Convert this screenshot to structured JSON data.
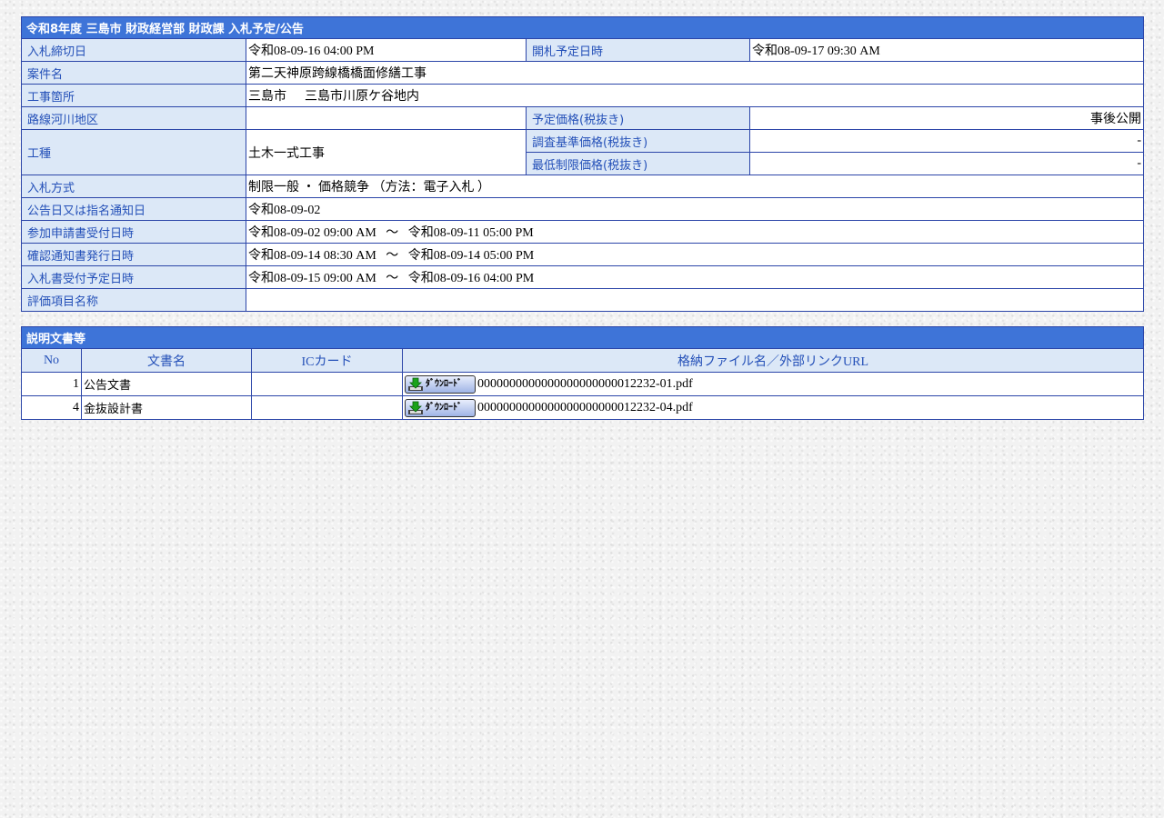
{
  "info_table": {
    "title": "令和8年度 三島市 財政経営部 財政課 入札予定/公告",
    "rows": {
      "deadline_label": "入札締切日",
      "deadline_value": "令和08-09-16 04:00 PM",
      "opening_label": "開札予定日時",
      "opening_value": "令和08-09-17 09:30 AM",
      "case_label": "案件名",
      "case_value": "第二天神原跨線橋橋面修繕工事",
      "location_label": "工事箇所",
      "location_city": "三島市",
      "location_detail": "三島市川原ケ谷地内",
      "route_label": "路線河川地区",
      "route_value": "",
      "planned_price_label": "予定価格(税抜き)",
      "planned_price_value": "事後公開",
      "work_type_label": "工種",
      "work_type_value": "土木一式工事",
      "survey_price_label": "調査基準価格(税抜き)",
      "survey_price_value": "-",
      "min_price_label": "最低制限価格(税抜き)",
      "min_price_value": "-",
      "method_label": "入札方式",
      "method_value": "制限一般 ・ 価格競争 （方法：電子入札 ）",
      "notice_date_label": "公告日又は指名通知日",
      "notice_date_value": "令和08-09-02",
      "application_label": "参加申請書受付日時",
      "application_start": "令和08-09-02 09:00 AM",
      "application_end": "令和08-09-11 05:00 PM",
      "confirm_label": "確認通知書発行日時",
      "confirm_start": "令和08-09-14 08:30 AM",
      "confirm_end": "令和08-09-14 05:00 PM",
      "bid_accept_label": "入札書受付予定日時",
      "bid_accept_start": "令和08-09-15 09:00 AM",
      "bid_accept_end": "令和08-09-16 04:00 PM",
      "eval_label": "評価項目名称",
      "eval_value": "",
      "range_sep": "～"
    }
  },
  "docs_table": {
    "title": "説明文書等",
    "headers": {
      "no": "No",
      "doc_name": "文書名",
      "ic_card": "ICカード",
      "file": "格納ファイル名／外部リンクURL"
    },
    "download_label": "ﾀﾞｳﾝﾛｰﾄﾞ",
    "rows": [
      {
        "no": "1",
        "doc_name": "公告文書",
        "ic_card": "",
        "file": "0000000000000000000000012232-01.pdf"
      },
      {
        "no": "4",
        "doc_name": "金抜設計書",
        "ic_card": "",
        "file": "0000000000000000000000012232-04.pdf"
      }
    ]
  },
  "colors": {
    "title_bg": "#3e74d8",
    "label_bg": "#dce8f7",
    "label_text": "#2450b8",
    "border": "#2b45a8"
  },
  "icons": {
    "download_button": "download-arrow-icon"
  }
}
